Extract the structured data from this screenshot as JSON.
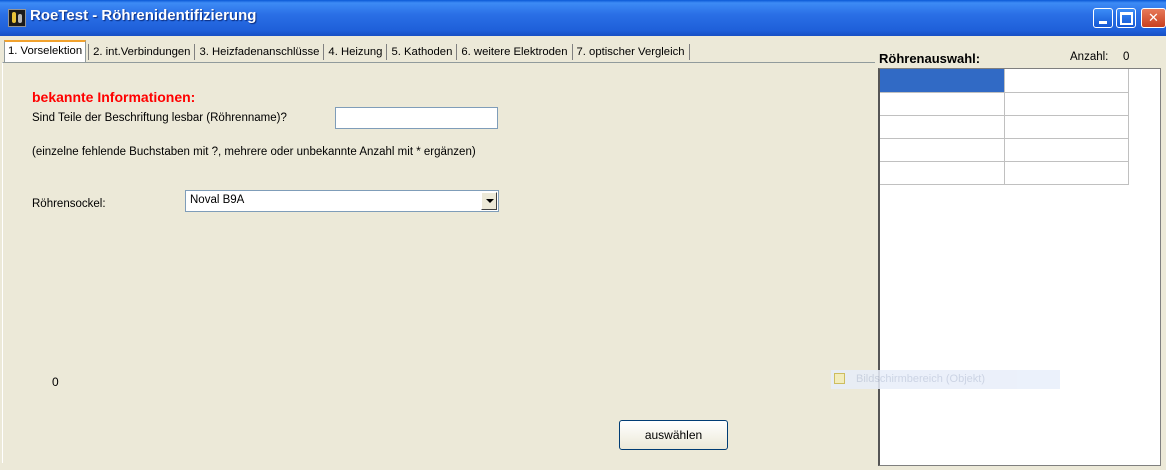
{
  "window": {
    "title": "RoeTest - Röhrenidentifizierung",
    "minimize_icon": "minimize-icon",
    "maximize_icon": "maximize-icon",
    "close_icon": "close-icon",
    "close_glyph": "✕"
  },
  "tabs": [
    {
      "label": "1. Vorselektion",
      "active": true
    },
    {
      "label": "2. int.Verbindungen"
    },
    {
      "label": "3. Heizfadenanschlüsse"
    },
    {
      "label": "4. Heizung"
    },
    {
      "label": "5. Kathoden"
    },
    {
      "label": "6. weitere Elektroden"
    },
    {
      "label": "7. optischer Vergleich"
    }
  ],
  "form": {
    "heading": "bekannte Informationen:",
    "label_name": "Sind Teile der Beschriftung lesbar (Röhrenname)?",
    "name_value": "",
    "hint": "(einzelne fehlende Buchstaben mit ?, mehrere oder unbekannte Anzahl mit * ergänzen)",
    "label_socket": "Röhrensockel:",
    "socket_value": "Noval B9A",
    "counter": "0",
    "select_button": "auswählen"
  },
  "selection": {
    "title": "Röhrenauswahl:",
    "count_label": "Anzahl:",
    "count_value": "0"
  },
  "overlay": {
    "text": "Bildschirmbereich (Objekt)"
  },
  "colors": {
    "heading": "#ff0000",
    "selected_cell": "#316ac5",
    "titlebar": "#2a6fe6"
  }
}
